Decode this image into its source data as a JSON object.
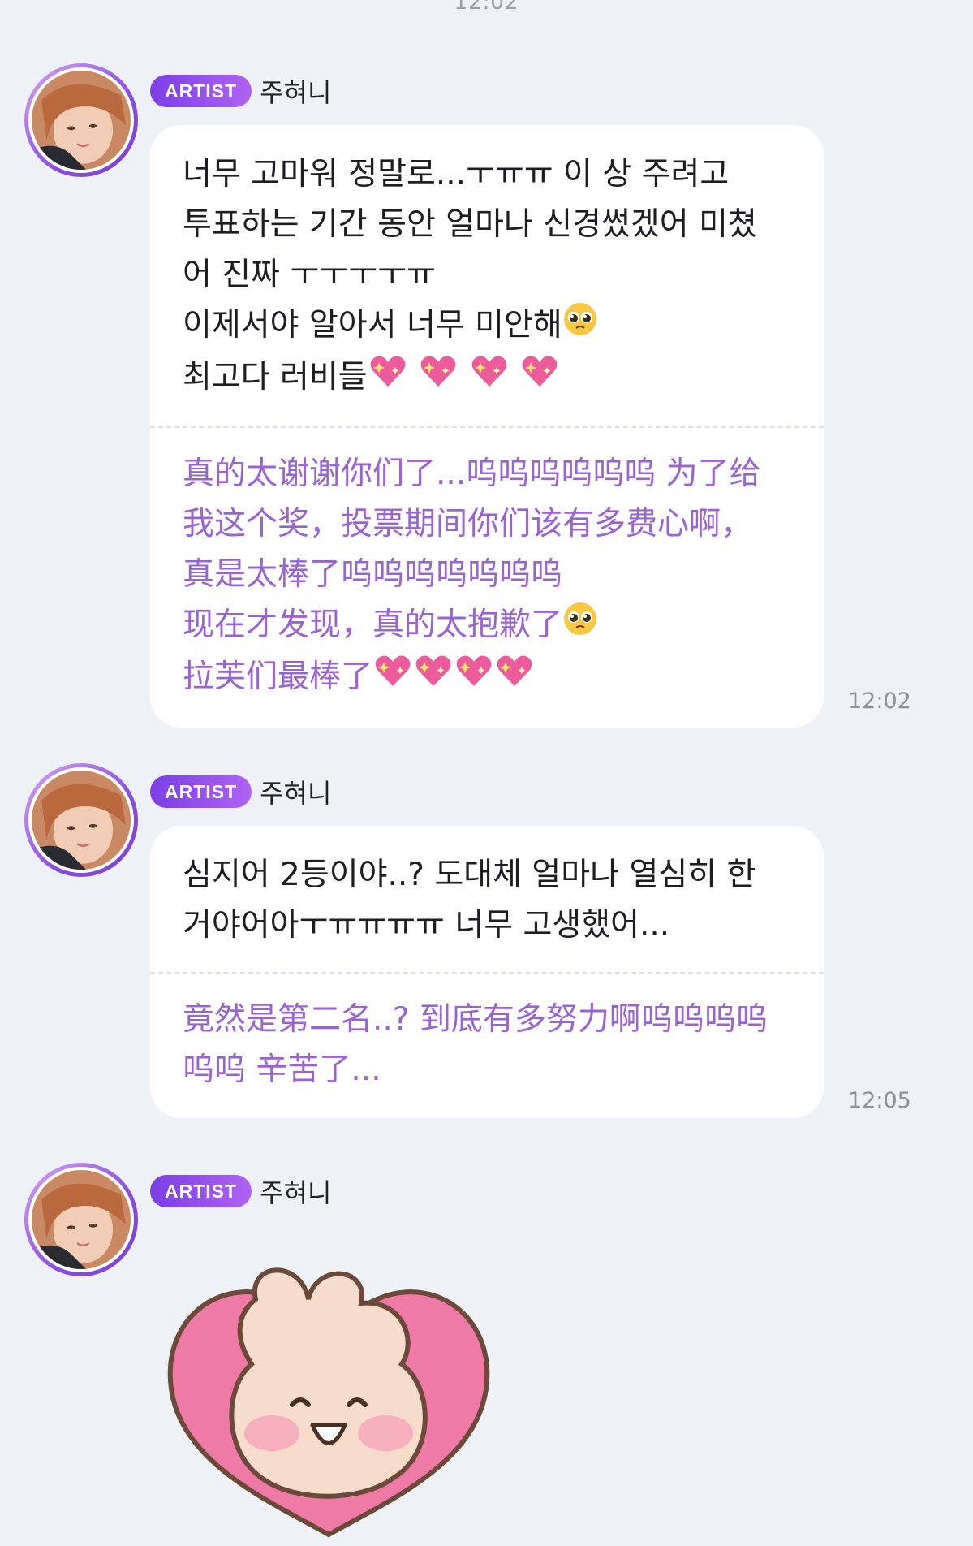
{
  "top_timestamp": "12:02",
  "messages": [
    {
      "badge": "ARTIST",
      "sender": "주혀니",
      "korean_lines": [
        "너무 고마워 정말로...ㅜㅠㅠ 이 상 주려고",
        "투표하는 기간 동안 얼마나 신경썼겠어 미쳤",
        "어 진짜 ㅜㅜㅜㅜㅠ",
        "이제서야 알아서 너무 미안해",
        "최고다 러비들"
      ],
      "chinese_lines": [
        "真的太谢谢你们了...呜呜呜呜呜呜 为了给",
        "我这个奖，投票期间你们该有多费心啊，",
        "真是太棒了呜呜呜呜呜呜呜",
        "现在才发现，真的太抱歉了",
        "拉芙们最棒了"
      ],
      "time": "12:02"
    },
    {
      "badge": "ARTIST",
      "sender": "주혀니",
      "korean_lines": [
        "심지어 2등이야..? 도대체 얼마나 열심히 한",
        "거야어아ㅜㅠㅠㅠㅠ 너무 고생했어..."
      ],
      "chinese_lines": [
        "竟然是第二名..? 到底有多努力啊呜呜呜呜",
        "呜呜 辛苦了..."
      ],
      "time": "12:05"
    },
    {
      "badge": "ARTIST",
      "sender": "주혀니",
      "sticker": "bunny-heart-sticker"
    }
  ],
  "colors": {
    "background": "#eef2f6",
    "badge_start": "#7a3fe4",
    "badge_end": "#b063f2",
    "translation_text": "#9a63d4"
  },
  "icons": [
    "pleading-face-emoji",
    "sparkling-heart-emoji",
    "avatar-photo",
    "bunny-heart-sticker"
  ]
}
